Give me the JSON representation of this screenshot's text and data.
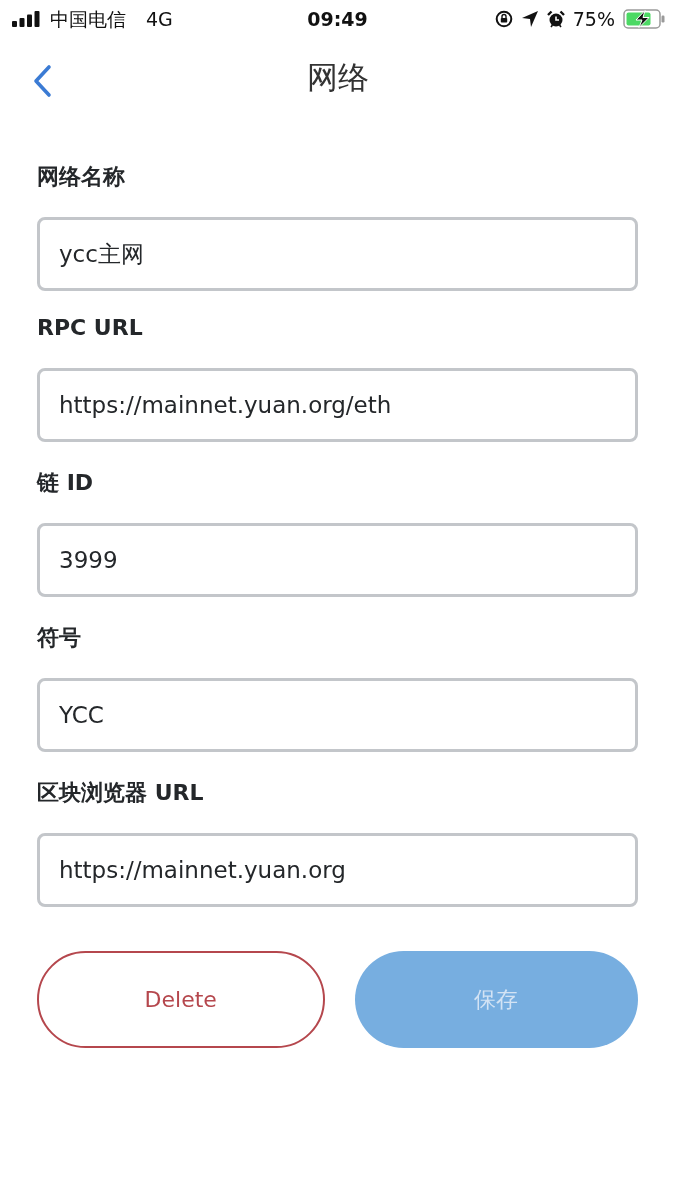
{
  "status_bar": {
    "carrier": "中国电信",
    "network": "4G",
    "time": "09:49",
    "battery_percent": "75%"
  },
  "header": {
    "title": "网络"
  },
  "fields": [
    {
      "label": "网络名称",
      "value": "ycc主网"
    },
    {
      "label": "RPC URL",
      "value": "https://mainnet.yuan.org/eth"
    },
    {
      "label": "链 ID",
      "value": "3999"
    },
    {
      "label": "符号",
      "value": "YCC"
    },
    {
      "label": "区块浏览器 URL",
      "value": "https://mainnet.yuan.org"
    }
  ],
  "buttons": [
    {
      "kind": "outline",
      "label": "Delete",
      "disabled": false
    },
    {
      "kind": "primary",
      "label": "保存",
      "disabled": true
    }
  ]
}
